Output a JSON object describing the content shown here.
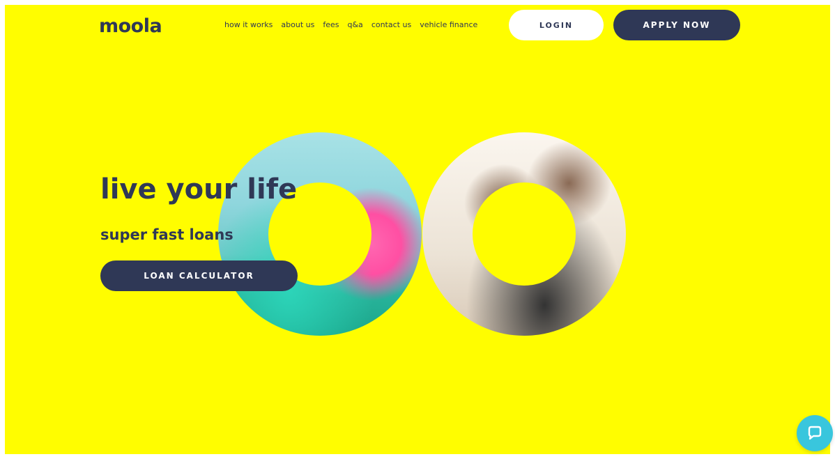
{
  "brand": {
    "logo_text": "moola",
    "accent_color": "#fffd00",
    "navy_color": "#2f3856",
    "chat_color": "#39c6dd"
  },
  "nav": {
    "items": [
      {
        "label": "how it works"
      },
      {
        "label": "about us"
      },
      {
        "label": "fees"
      },
      {
        "label": "q&a"
      },
      {
        "label": "contact us"
      },
      {
        "label": "vehicle finance"
      }
    ],
    "login_label": "LOGIN",
    "apply_label": "APPLY NOW"
  },
  "hero": {
    "headline": "live your life",
    "subhead": "super fast loans",
    "cta_label": "LOAN CALCULATOR"
  },
  "icons": {
    "chat": "chat-bubble-icon"
  }
}
